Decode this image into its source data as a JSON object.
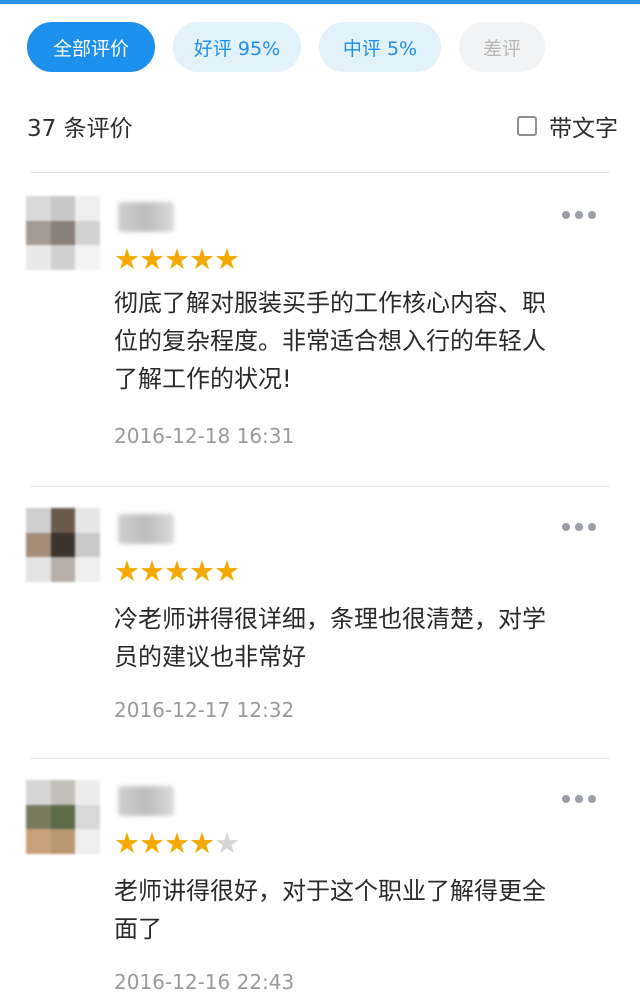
{
  "filters": [
    {
      "label": "全部评价",
      "active": true
    },
    {
      "label": "好评 95%",
      "active": false
    },
    {
      "label": "中评 5%",
      "active": false
    },
    {
      "label": "差评",
      "active": false
    }
  ],
  "summary": {
    "count_label": "37 条评价",
    "text_filter_label": "带文字"
  },
  "reviews": [
    {
      "stars": 5,
      "text": "彻底了解对服装买手的工作核心内容、职位的复杂程度。非常适合想入行的年轻人了解工作的状况!",
      "date": "2016-12-18 16:31"
    },
    {
      "stars": 5,
      "text": "冷老师讲得很详细，条理也很清楚，对学员的建议也非常好",
      "date": "2016-12-17 12:32"
    },
    {
      "stars": 4,
      "text": "老师讲得很好，对于这个职业了解得更全面了",
      "date": "2016-12-16 22:43"
    }
  ],
  "colors": {
    "accent": "#1d8fec",
    "star": "#f4a900",
    "star_empty": "#d5d5d5",
    "muted": "#9a9a9a"
  },
  "icons": {
    "more": "more-horizontal-icon",
    "star": "star-icon",
    "checkbox": "checkbox-icon"
  }
}
